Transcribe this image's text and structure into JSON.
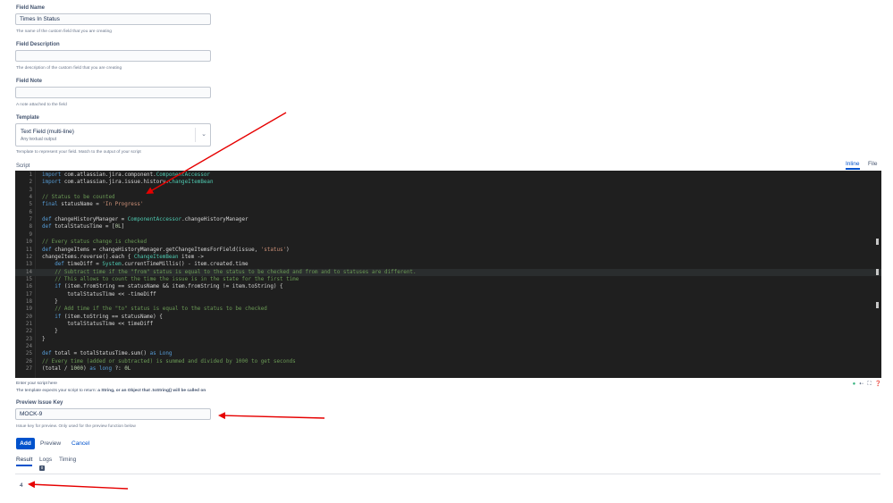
{
  "form": {
    "field_name": {
      "label": "Field Name",
      "value": "Times In Status",
      "help": "The name of the custom field that you are creating"
    },
    "field_description": {
      "label": "Field Description",
      "value": "",
      "help": "The description of the custom field that you are creating"
    },
    "field_note": {
      "label": "Field Note",
      "value": "",
      "help": "A note attached to the field"
    },
    "template": {
      "label": "Template",
      "selected": "Text Field (multi-line)",
      "selected_sub": "Any textual output",
      "help": "Template to represent your field. Match to the output of your script"
    }
  },
  "script": {
    "label": "Script",
    "tabs": [
      "Inline",
      "File"
    ],
    "active_tab": "Inline",
    "lines": [
      {
        "n": "1",
        "text": "import com.atlassian.jira.component.ComponentAccessor"
      },
      {
        "n": "2",
        "text": "import com.atlassian.jira.issue.history.ChangeItemBean"
      },
      {
        "n": "3",
        "text": ""
      },
      {
        "n": "4",
        "text": "// Status to be counted"
      },
      {
        "n": "5",
        "text": "final statusName = 'In Progress'"
      },
      {
        "n": "6",
        "text": ""
      },
      {
        "n": "7",
        "text": "def changeHistoryManager = ComponentAccessor.changeHistoryManager"
      },
      {
        "n": "8",
        "text": "def totalStatusTime = [0L]"
      },
      {
        "n": "9",
        "text": ""
      },
      {
        "n": "10",
        "text": "// Every status change is checked"
      },
      {
        "n": "11",
        "text": "def changeItems = changeHistoryManager.getChangeItemsForField(issue, 'status')"
      },
      {
        "n": "12",
        "text": "changeItems.reverse().each { ChangeItemBean item ->"
      },
      {
        "n": "13",
        "text": "    def timeDiff = System.currentTimeMillis() - item.created.time"
      },
      {
        "n": "14",
        "text": "    // Subtract time if the \"from\" status is equal to the status to be checked and from and to statuses are different."
      },
      {
        "n": "15",
        "text": "    // This allows to count the time the issue is in the state for the first time"
      },
      {
        "n": "16",
        "text": "    if (item.fromString == statusName && item.fromString != item.toString) {"
      },
      {
        "n": "17",
        "text": "        totalStatusTime << -timeDiff"
      },
      {
        "n": "18",
        "text": "    }"
      },
      {
        "n": "19",
        "text": "    // Add time if the \"to\" status is equal to the status to be checked"
      },
      {
        "n": "20",
        "text": "    if (item.toString == statusName) {"
      },
      {
        "n": "21",
        "text": "        totalStatusTime << timeDiff"
      },
      {
        "n": "22",
        "text": "    }"
      },
      {
        "n": "23",
        "text": "}"
      },
      {
        "n": "24",
        "text": ""
      },
      {
        "n": "25",
        "text": "def total = totalStatusTime.sum() as Long"
      },
      {
        "n": "26",
        "text": "// Every time (added or subtracted) is summed and divided by 1000 to get seconds"
      },
      {
        "n": "27",
        "text": "(total / 1000) as long ?: 0L"
      }
    ],
    "active_line": "14",
    "help": "Enter your script here",
    "expect_prefix": "The template expects your script to return: ",
    "expect_bold": "a String, or an Object that .toString() will be called on",
    "colors": {
      "bg": "#1f1f1f",
      "comment": "#6a9955",
      "keyword": "#569cd6",
      "string": "#ce9178",
      "number": "#b5cea8",
      "type": "#4ec9b0",
      "text": "#d4d4d4"
    }
  },
  "preview": {
    "label": "Preview Issue Key",
    "value": "MOCK-9",
    "help": "Issue key for preview. Only used for the preview function below"
  },
  "actions": {
    "add": "Add",
    "preview": "Preview",
    "cancel": "Cancel"
  },
  "results": {
    "tabs": [
      "Result",
      "Logs",
      "Timing"
    ],
    "active_tab": "Result",
    "logs_badge": "0",
    "value": "4"
  },
  "icons": {
    "editor_tools": [
      "status-ok-icon",
      "arrow-left-icon",
      "fullscreen-icon",
      "help-icon"
    ]
  },
  "annotation_color": "#e60000"
}
